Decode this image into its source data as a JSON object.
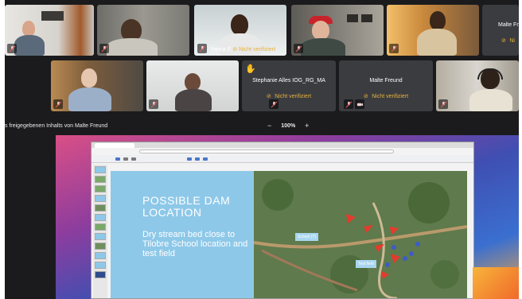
{
  "participants": {
    "row1": [
      {
        "id": "p1"
      },
      {
        "id": "p2"
      },
      {
        "id": "p3",
        "name": "Yanna E",
        "status": "Nicht verifiziert",
        "active": true
      },
      {
        "id": "p4"
      },
      {
        "id": "p5"
      },
      {
        "id": "p6",
        "name": "Malte Fr",
        "status": "Ni"
      }
    ],
    "row2": [
      {
        "id": "p7"
      },
      {
        "id": "p8"
      },
      {
        "id": "p9",
        "name": "Stephanie Alles IOG_RG_MA",
        "status": "Nicht verifiziert",
        "raised_hand": true
      },
      {
        "id": "p10",
        "name": "Malte Freund",
        "status": "Nicht verifiziert"
      },
      {
        "id": "p11"
      }
    ]
  },
  "share_bar": {
    "label": "s freigegebenen Inhalts von Malte Freund",
    "zoom_out": "−",
    "zoom_value": "100%",
    "zoom_in": "+"
  },
  "slide": {
    "title": "POSSIBLE DAM LOCATION",
    "body": "Dry stream bed close to Tilobre School location and test field",
    "map_labels": {
      "school": "School (T)",
      "test_field": "Test field"
    }
  },
  "icons": {
    "mic": "mic-muted-icon",
    "camera": "camera-off-icon",
    "warning": "not-verified-icon",
    "hand": "raised-hand-icon"
  },
  "colors": {
    "active_border": "#6ec9b9",
    "warning": "#e6b23a",
    "slide_blue": "#8ec8e8"
  }
}
